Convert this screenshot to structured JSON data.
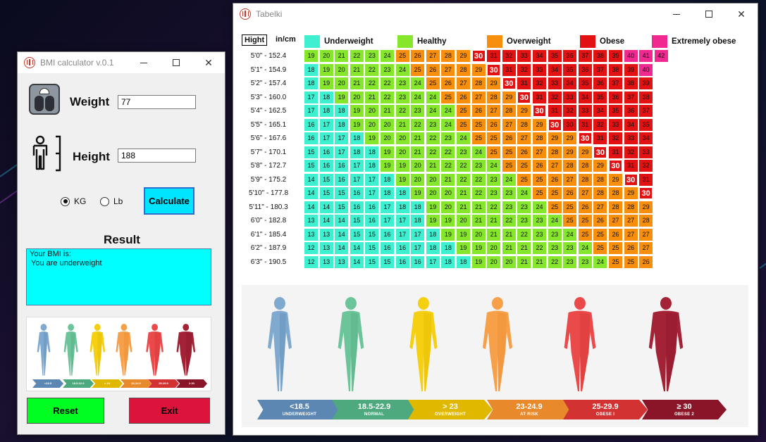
{
  "bmi_window": {
    "title": "BMI calculator v.0.1",
    "weight_label": "Weight",
    "weight_value": "77",
    "height_label": "Height",
    "height_value": "188",
    "units": [
      {
        "label": "KG",
        "selected": true
      },
      {
        "label": "Lb",
        "selected": false
      }
    ],
    "calculate_label": "Calculate",
    "result_title": "Result",
    "result_lines": [
      "Your BMI is:",
      "You are underweight"
    ],
    "reset_label": "Reset",
    "exit_label": "Exit"
  },
  "table_window": {
    "title": "Tabelki",
    "hight_label": "Hight",
    "unit_label": "in/cm",
    "legend": [
      {
        "label": "Underweight",
        "color": "#3ef0d0"
      },
      {
        "label": "Healthy",
        "color": "#86e62c"
      },
      {
        "label": "Overweight",
        "color": "#f78e0c"
      },
      {
        "label": "Obese",
        "color": "#e31212"
      },
      {
        "label": "Extremely obese",
        "color": "#f02890"
      }
    ],
    "heights": [
      "5'0\" - 152.4",
      "5'1\" - 154.9",
      "5'2\" - 157.4",
      "5'3\" - 160.0",
      "5'4\" - 162.5",
      "5'5\" - 165.1",
      "5'6\" - 167.6",
      "5'7\" - 170.1",
      "5'8\" - 172.7",
      "5'9\" - 175.2",
      "5'10\" - 177.8",
      "5'11\" - 180.3",
      "6'0\" - 182.8",
      "6'1\" - 185.4",
      "6'2\" - 187.9",
      "6'3\" - 190.5"
    ],
    "bmi_rows": [
      [
        19,
        20,
        21,
        22,
        23,
        24,
        25,
        26,
        27,
        28,
        29,
        30,
        31,
        32,
        33,
        34,
        35,
        36,
        37,
        38,
        39,
        40,
        41,
        42
      ],
      [
        18,
        19,
        20,
        21,
        22,
        23,
        24,
        25,
        26,
        27,
        28,
        29,
        30,
        31,
        32,
        33,
        34,
        35,
        36,
        37,
        38,
        39,
        40
      ],
      [
        18,
        19,
        20,
        21,
        22,
        22,
        23,
        24,
        25,
        26,
        27,
        28,
        29,
        30,
        31,
        32,
        33,
        34,
        35,
        36,
        37,
        38,
        39
      ],
      [
        17,
        18,
        19,
        20,
        21,
        22,
        23,
        24,
        24,
        25,
        26,
        27,
        28,
        29,
        30,
        31,
        32,
        33,
        34,
        35,
        36,
        37,
        38
      ],
      [
        17,
        18,
        18,
        19,
        20,
        21,
        22,
        23,
        24,
        24,
        25,
        26,
        27,
        28,
        29,
        30,
        31,
        32,
        33,
        34,
        35,
        36,
        37
      ],
      [
        16,
        17,
        18,
        19,
        20,
        20,
        21,
        22,
        23,
        24,
        25,
        25,
        26,
        27,
        28,
        29,
        30,
        30,
        31,
        32,
        33,
        34,
        35
      ],
      [
        16,
        17,
        17,
        18,
        19,
        20,
        20,
        21,
        22,
        23,
        24,
        25,
        25,
        26,
        27,
        28,
        29,
        29,
        30,
        31,
        32,
        33,
        34
      ],
      [
        15,
        16,
        17,
        18,
        18,
        19,
        20,
        21,
        22,
        22,
        23,
        24,
        25,
        25,
        26,
        27,
        28,
        29,
        29,
        30,
        31,
        32,
        33
      ],
      [
        15,
        16,
        16,
        17,
        18,
        19,
        19,
        20,
        21,
        22,
        22,
        23,
        24,
        25,
        25,
        26,
        27,
        28,
        28,
        29,
        30,
        31,
        32
      ],
      [
        14,
        15,
        16,
        17,
        17,
        18,
        19,
        20,
        20,
        21,
        22,
        22,
        23,
        24,
        25,
        25,
        26,
        27,
        28,
        28,
        29,
        30,
        31
      ],
      [
        14,
        15,
        15,
        16,
        17,
        18,
        18,
        19,
        20,
        20,
        21,
        22,
        23,
        23,
        24,
        25,
        25,
        26,
        27,
        28,
        28,
        29,
        30
      ],
      [
        14,
        14,
        15,
        16,
        16,
        17,
        18,
        18,
        19,
        20,
        21,
        21,
        22,
        23,
        23,
        24,
        25,
        25,
        26,
        27,
        28,
        28,
        29
      ],
      [
        13,
        14,
        14,
        15,
        16,
        17,
        17,
        18,
        19,
        19,
        20,
        21,
        21,
        22,
        23,
        23,
        24,
        25,
        25,
        26,
        27,
        27,
        28
      ],
      [
        13,
        13,
        14,
        15,
        15,
        16,
        17,
        17,
        18,
        19,
        19,
        20,
        21,
        21,
        22,
        23,
        23,
        24,
        25,
        25,
        26,
        27,
        27
      ],
      [
        12,
        13,
        14,
        14,
        15,
        16,
        16,
        17,
        18,
        18,
        19,
        19,
        20,
        21,
        21,
        22,
        23,
        23,
        24,
        25,
        25,
        26,
        27
      ],
      [
        12,
        13,
        13,
        14,
        15,
        15,
        16,
        16,
        17,
        18,
        18,
        19,
        20,
        20,
        21,
        21,
        22,
        23,
        23,
        24,
        25,
        25,
        26
      ]
    ],
    "categories": [
      {
        "value": "<18.5",
        "caption": "UNDERWEIGHT",
        "color": "#7fa9cf",
        "dark": "#5c87b3"
      },
      {
        "value": "18.5-22.9",
        "caption": "NORMAL",
        "color": "#6cc49a",
        "dark": "#4ea97e"
      },
      {
        "value": "> 23",
        "caption": "OVERWEIGHT",
        "color": "#f5cf12",
        "dark": "#e1b800"
      },
      {
        "value": "23-24.9",
        "caption": "AT RISK",
        "color": "#f7a04a",
        "dark": "#e88a2c"
      },
      {
        "value": "25-29.9",
        "caption": "OBESE I",
        "color": "#ea4a4a",
        "dark": "#d33232"
      },
      {
        "value": "≥ 30",
        "caption": "OBESE 2",
        "color": "#a32236",
        "dark": "#8a1428"
      }
    ]
  }
}
